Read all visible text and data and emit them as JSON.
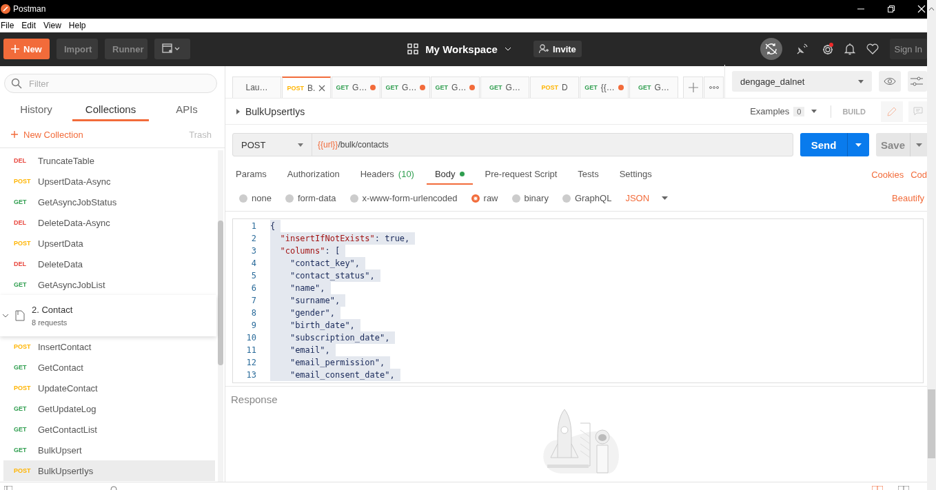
{
  "window": {
    "title": "Postman"
  },
  "menu": [
    "File",
    "Edit",
    "View",
    "Help"
  ],
  "toolbar": {
    "new_label": "New",
    "import_label": "Import",
    "runner_label": "Runner",
    "workspace": "My Workspace",
    "invite_label": "Invite",
    "sign_in_label": "Sign In",
    "settings_alert": true
  },
  "sidebar": {
    "filter_placeholder": "Filter",
    "tabs": [
      {
        "label": "History",
        "selected": false
      },
      {
        "label": "Collections",
        "selected": true
      },
      {
        "label": "APIs",
        "selected": false
      }
    ],
    "new_collection": "New Collection",
    "trash": "Trash",
    "items": [
      {
        "kind": "request",
        "method": "DEL",
        "color": "#e8453c",
        "name": "TruncateTable",
        "selected": false
      },
      {
        "kind": "request",
        "method": "POST",
        "color": "#ffb400",
        "name": "UpsertData-Async",
        "selected": false
      },
      {
        "kind": "request",
        "method": "GET",
        "color": "#2f9e4f",
        "name": "GetAsyncJobStatus",
        "selected": false
      },
      {
        "kind": "request",
        "method": "DEL",
        "color": "#e8453c",
        "name": "DeleteData-Async",
        "selected": false
      },
      {
        "kind": "request",
        "method": "POST",
        "color": "#ffb400",
        "name": "UpsertData",
        "selected": false
      },
      {
        "kind": "request",
        "method": "DEL",
        "color": "#e8453c",
        "name": "DeleteData",
        "selected": false
      },
      {
        "kind": "request",
        "method": "GET",
        "color": "#2f9e4f",
        "name": "GetAsyncJobList",
        "selected": false
      },
      {
        "kind": "folder",
        "name": "2. Contact",
        "subtitle": "8 requests",
        "expanded": true,
        "selected": false
      },
      {
        "kind": "request",
        "method": "POST",
        "color": "#ffb400",
        "name": "InsertContact",
        "selected": false
      },
      {
        "kind": "request",
        "method": "GET",
        "color": "#2f9e4f",
        "name": "GetContact",
        "selected": false
      },
      {
        "kind": "request",
        "method": "POST",
        "color": "#ffb400",
        "name": "UpdateContact",
        "selected": false
      },
      {
        "kind": "request",
        "method": "GET",
        "color": "#2f9e4f",
        "name": "GetUpdateLog",
        "selected": false
      },
      {
        "kind": "request",
        "method": "GET",
        "color": "#2f9e4f",
        "name": "GetContactList",
        "selected": false
      },
      {
        "kind": "request",
        "method": "GET",
        "color": "#2f9e4f",
        "name": "BulkUpsert",
        "selected": false
      },
      {
        "kind": "request",
        "method": "POST",
        "color": "#ffb400",
        "name": "BulkUpsertIys",
        "selected": true
      }
    ]
  },
  "request_tabs": [
    {
      "label": "Lau…",
      "selected": false,
      "unsaved": false
    },
    {
      "method": "POST",
      "color": "#ffb400",
      "label": "B.",
      "selected": true,
      "unsaved": false
    },
    {
      "method": "GET",
      "color": "#2f9e4f",
      "label": "G…",
      "selected": false,
      "unsaved": true
    },
    {
      "method": "GET",
      "color": "#2f9e4f",
      "label": "G…",
      "selected": false,
      "unsaved": true
    },
    {
      "method": "GET",
      "color": "#2f9e4f",
      "label": "G…",
      "selected": false,
      "unsaved": true
    },
    {
      "method": "GET",
      "color": "#2f9e4f",
      "label": "G…",
      "selected": false,
      "unsaved": false
    },
    {
      "method": "POST",
      "color": "#ffb400",
      "label": "D",
      "selected": false,
      "unsaved": false
    },
    {
      "method": "GET",
      "color": "#2f9e4f",
      "label": "{{…",
      "selected": false,
      "unsaved": true
    },
    {
      "method": "GET",
      "color": "#2f9e4f",
      "label": "G…",
      "selected": false,
      "unsaved": false
    }
  ],
  "environment": "dengage_dalnet",
  "request": {
    "name": "BulkUpsertIys",
    "examples_label": "Examples",
    "examples_count": "0",
    "build_label": "BUILD",
    "method": "POST",
    "url_variable": "{{url}}",
    "url_path": "/bulk/contacts",
    "send_label": "Send",
    "save_label": "Save"
  },
  "request_sections": [
    {
      "label": "Params",
      "selected": false,
      "has_content": false
    },
    {
      "label": "Authorization",
      "selected": false,
      "has_content": false
    },
    {
      "label": "Headers",
      "count": "(10)",
      "selected": false,
      "has_content": false
    },
    {
      "label": "Body",
      "selected": true,
      "has_content": true
    },
    {
      "label": "Pre-request Script",
      "selected": false,
      "has_content": false
    },
    {
      "label": "Tests",
      "selected": false,
      "has_content": false
    },
    {
      "label": "Settings",
      "selected": false,
      "has_content": false
    }
  ],
  "section_links": [
    "Cookies",
    "Cod"
  ],
  "body_types": [
    {
      "label": "none",
      "selected": false
    },
    {
      "label": "form-data",
      "selected": false
    },
    {
      "label": "x-www-form-urlencoded",
      "selected": false
    },
    {
      "label": "raw",
      "selected": true
    },
    {
      "label": "binary",
      "selected": false
    },
    {
      "label": "GraphQL",
      "selected": false
    }
  ],
  "body_format": "JSON",
  "beautify_label": "Beautify",
  "code_lines": [
    {
      "number": "1",
      "text": "{"
    },
    {
      "number": "2",
      "text": "  \"insertIfNotExists\": true,"
    },
    {
      "number": "3",
      "text": "  \"columns\": ["
    },
    {
      "number": "4",
      "text": "    \"contact_key\","
    },
    {
      "number": "5",
      "text": "    \"contact_status\","
    },
    {
      "number": "6",
      "text": "    \"name\","
    },
    {
      "number": "7",
      "text": "    \"surname\","
    },
    {
      "number": "8",
      "text": "    \"gender\","
    },
    {
      "number": "9",
      "text": "    \"birth_date\","
    },
    {
      "number": "10",
      "text": "    \"subscription_date\","
    },
    {
      "number": "11",
      "text": "    \"email\","
    },
    {
      "number": "12",
      "text": "    \"email_permission\","
    },
    {
      "number": "13",
      "text": "    \"email_consent_date\","
    }
  ],
  "response": {
    "title": "Response"
  }
}
